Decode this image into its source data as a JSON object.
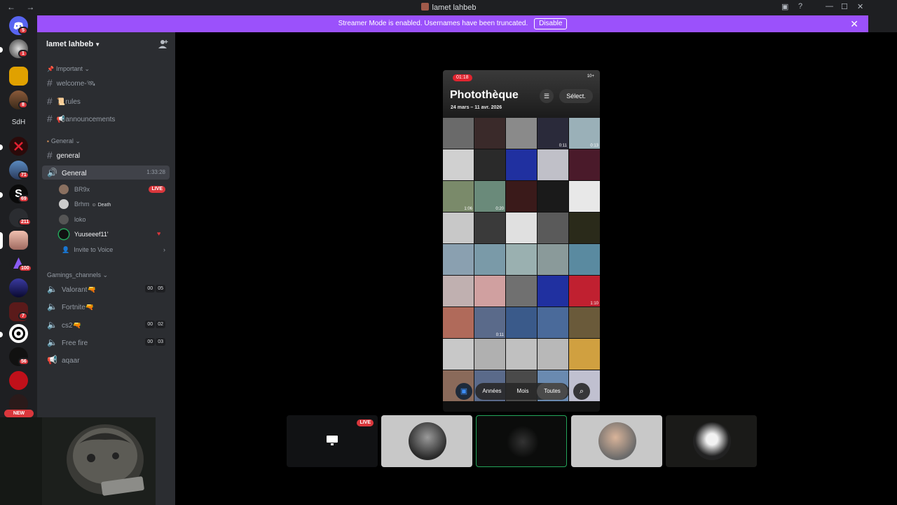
{
  "window": {
    "title": "lamet lahbeb",
    "nav": "← →",
    "controls": [
      "inbox",
      "help",
      "minimize",
      "maximize",
      "close"
    ]
  },
  "banner": {
    "text": "Streamer Mode is enabled. Usernames have been truncated.",
    "button": "Disable",
    "close": "✕"
  },
  "rail": {
    "badges": [
      "5",
      "1",
      "8",
      "71",
      "69",
      "211",
      "100",
      "7",
      "56"
    ],
    "sdh_label": "SdH",
    "new_label": "NEW"
  },
  "server": {
    "name": "lamet lahbeb",
    "categories": {
      "important": "Important",
      "general": "General",
      "gaming": "Gamings_channels"
    },
    "channels": {
      "welcome": "welcome-🛰",
      "rules": "📜rules",
      "announcements": "📢announcements",
      "general_text": "general",
      "general_voice": "General",
      "general_voice_time": "1:33:28",
      "valorant": "Valorant🔫",
      "fortnite": "Fortnite🔫",
      "cs2": "cs2🔫",
      "freefire": "Free fire",
      "aqaar": "aqaar"
    },
    "voice_counts": {
      "valorant": [
        "00",
        "05"
      ],
      "cs2": [
        "00",
        "02"
      ],
      "freefire": [
        "00",
        "03"
      ]
    },
    "voice_users": [
      {
        "name": "BR9x",
        "tag": "LIVE",
        "status": ""
      },
      {
        "name": "Brhm",
        "tag": "",
        "status": "Death"
      },
      {
        "name": "loko",
        "tag": "",
        "status": ""
      },
      {
        "name": "Yuuseeef11'",
        "tag": "",
        "status": ""
      }
    ],
    "invite": "Invite to Voice"
  },
  "phone": {
    "rec_time": "01:18",
    "signal": "10+",
    "title": "Photothèque",
    "dates": "24 mars – 11 avr. 2026",
    "select_label": "Sélect.",
    "tabs": [
      "Années",
      "Mois",
      "Toutes"
    ],
    "selected_tab": "Toutes",
    "durations": [
      "0:11",
      "0:13",
      "1:06",
      "0:20",
      "1:10",
      "0:11"
    ]
  },
  "tiles": {
    "live_label": "LIVE"
  },
  "colors": {
    "banner": "#9b51fb",
    "live": "#da373c",
    "speaking": "#23a55a",
    "sidebar": "#2b2d31",
    "rail": "#1e1f22"
  }
}
